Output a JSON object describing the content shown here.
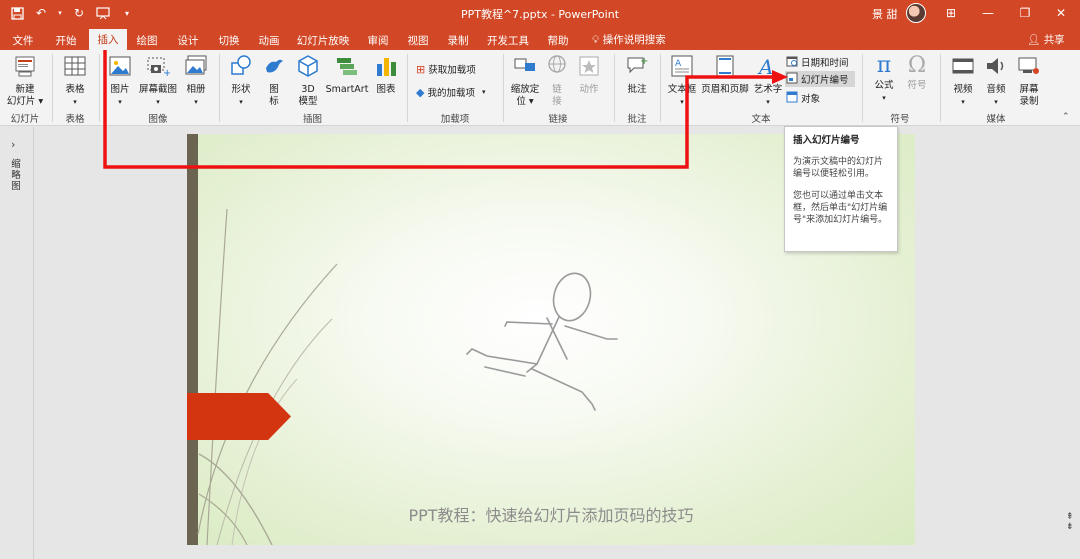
{
  "window": {
    "title": "PPT教程^7.pptx  -  PowerPoint",
    "user_name": "景 甜",
    "controls": {
      "ribbon_display": "⊞",
      "minimize": "—",
      "restore": "❐",
      "close": "✕"
    }
  },
  "quick_access": {
    "save_icon": "save-icon",
    "undo_icon": "undo-icon",
    "redo_icon": "redo-icon",
    "customize_icon": "customize-icon"
  },
  "tabs": [
    "文件",
    "开始",
    "插入",
    "绘图",
    "设计",
    "切换",
    "动画",
    "幻灯片放映",
    "审阅",
    "视图",
    "录制",
    "开发工具",
    "帮助"
  ],
  "active_tab": "插入",
  "search_label": "操作说明搜索",
  "share_label": "共享",
  "ribbon": {
    "groups": {
      "slides": {
        "label": "幻灯片",
        "new_slide": "新建\n幻灯片 ▾"
      },
      "tables": {
        "label": "表格",
        "table": "表格"
      },
      "images": {
        "label": "图像",
        "pictures": "图片",
        "screenshot": "屏幕截图",
        "album": "相册"
      },
      "illustrations": {
        "label": "插图",
        "shapes": "形状",
        "icons": "图\n标",
        "models": "3D\n模型",
        "smartart": "SmartArt",
        "chart": "图表"
      },
      "addins": {
        "label": "加载项",
        "get": "获取加载项",
        "mine": "我的加载项"
      },
      "links": {
        "label": "链接",
        "zoom": "缩放定\n位 ▾",
        "link": "链\n接",
        "action": "动作"
      },
      "comments": {
        "label": "批注",
        "comment": "批注"
      },
      "text": {
        "label": "文本",
        "textbox": "文本框",
        "header_footer": "页眉和页脚",
        "wordart": "艺术字",
        "date_time": "日期和时间",
        "slide_number": "幻灯片编号",
        "object": "对象"
      },
      "symbols": {
        "label": "符号",
        "equation": "公式",
        "symbol": "符号"
      },
      "media": {
        "label": "媒体",
        "video": "视频",
        "audio": "音频",
        "screen_record": "屏幕\n录制"
      }
    }
  },
  "left_pane": {
    "label": "缩\n略\n图"
  },
  "tooltip": {
    "title": "插入幻灯片编号",
    "body": "为演示文稿中的幻灯片编号以便轻松引用。",
    "body2": "您也可以通过单击文本框，然后单击\"幻灯片编号\"来添加幻灯片编号。"
  },
  "slide": {
    "caption": "PPT教程：快速给幻灯片添加页码的技巧"
  },
  "colors": {
    "accent": "#d24726",
    "annotation": "#ee1111",
    "slide_tag": "#d33511"
  }
}
